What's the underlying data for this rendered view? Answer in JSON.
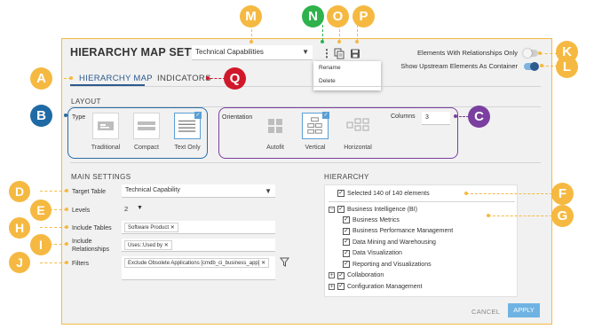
{
  "header": {
    "title": "HIERARCHY MAP SETTINGS",
    "config_select": "Technical Capabilities",
    "kebab_glyph": "⋮",
    "menu": [
      "Rename",
      "Delete"
    ]
  },
  "toggles": {
    "elements_with_relationships": {
      "label": "Elements With Relationships Only",
      "on": false
    },
    "show_upstream": {
      "label": "Show Upstream Elements As Container",
      "on": true
    }
  },
  "tabs": [
    {
      "label": "HIERARCHY MAP",
      "active": true
    },
    {
      "label": "INDICATORS",
      "active": false
    }
  ],
  "layout": {
    "section": "LAYOUT",
    "type_label": "Type",
    "types": [
      {
        "label": "Traditional",
        "selected": false
      },
      {
        "label": "Compact",
        "selected": false
      },
      {
        "label": "Text Only",
        "selected": true
      }
    ],
    "orientation_label": "Orientation",
    "orientations": [
      {
        "label": "Autofit",
        "selected": false
      },
      {
        "label": "Vertical",
        "selected": true
      },
      {
        "label": "Horizontal",
        "selected": false
      }
    ],
    "columns_label": "Columns",
    "columns_value": "3"
  },
  "main_settings": {
    "section": "MAIN SETTINGS",
    "target_table_label": "Target Table",
    "target_table_value": "Technical Capability",
    "levels_label": "Levels",
    "levels_value": "2",
    "include_tables_label": "Include Tables",
    "include_tables_chips": [
      "Software Product"
    ],
    "include_relationships_label": "Include Relationships",
    "include_relationships_chips": [
      "Uses::Used by"
    ],
    "filters_label": "Filters",
    "filters_chips": [
      "Exclude Obsolete Applications [cmdb_ci_business_app]"
    ],
    "chip_remove_glyph": "✕",
    "caret_glyph": "▼"
  },
  "hierarchy": {
    "section": "HIERARCHY",
    "summary": "Selected 140 of 140 elements",
    "items": [
      {
        "label": "Business Intelligence (BI)",
        "level": 0,
        "expander": "−"
      },
      {
        "label": "Business Metrics",
        "level": 1,
        "expander": ""
      },
      {
        "label": "Business Performance Management",
        "level": 1,
        "expander": ""
      },
      {
        "label": "Data Mining and Warehousing",
        "level": 1,
        "expander": ""
      },
      {
        "label": "Data Visualization",
        "level": 1,
        "expander": ""
      },
      {
        "label": "Reporting and Visualizations",
        "level": 1,
        "expander": ""
      },
      {
        "label": "Collaboration",
        "level": 0,
        "expander": "+"
      },
      {
        "label": "Configuration Management",
        "level": 0,
        "expander": "+"
      }
    ]
  },
  "footer": {
    "cancel": "CANCEL",
    "apply": "APPLY"
  },
  "callouts": {
    "A": "A",
    "B": "B",
    "C": "C",
    "D": "D",
    "E": "E",
    "F": "F",
    "G": "G",
    "H": "H",
    "I": "I",
    "J": "J",
    "K": "K",
    "L": "L",
    "M": "M",
    "N": "N",
    "O": "O",
    "P": "P",
    "Q": "Q"
  },
  "colors": {
    "accent_blue": "#2d5a8f",
    "apply_blue": "#6fb3e3",
    "callout_orange": "#f5b942",
    "callout_green": "#2fb24c",
    "callout_red": "#d0182a",
    "callout_blue": "#1f6aa5",
    "callout_purple": "#7b3fa0"
  }
}
